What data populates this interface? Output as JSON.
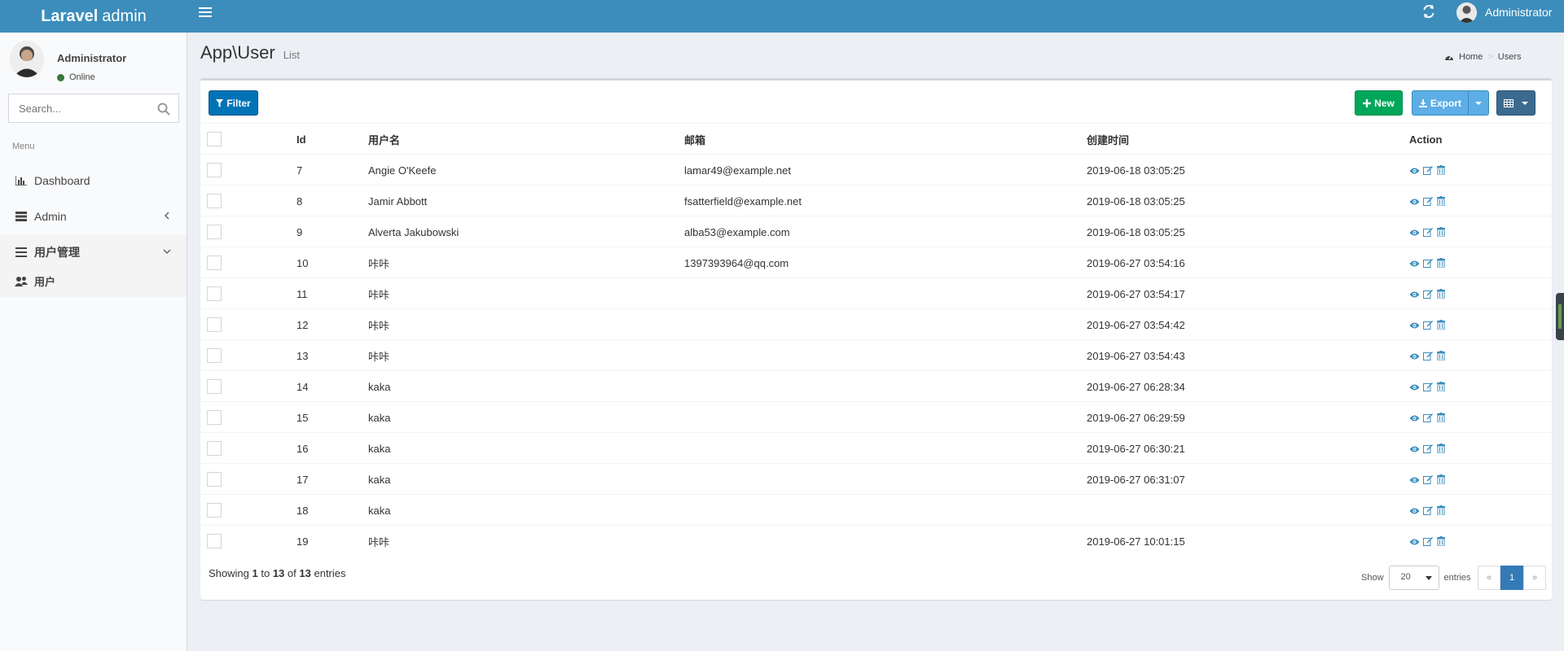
{
  "header": {
    "logo_bold": "Laravel",
    "logo_rest": "admin",
    "user_name": "Administrator"
  },
  "sidebar": {
    "user_name": "Administrator",
    "status": "Online",
    "search_placeholder": "Search...",
    "menu_header": "Menu",
    "items": [
      {
        "label": "Dashboard",
        "icon": "bar-chart-icon"
      },
      {
        "label": "Admin",
        "icon": "tasks-icon"
      },
      {
        "label": "用户管理",
        "icon": "bars-icon"
      }
    ],
    "sub_items": [
      {
        "label": "用户",
        "icon": "users-icon"
      }
    ]
  },
  "content": {
    "title": "App\\User",
    "subtitle": "List",
    "breadcrumb_home": "Home",
    "breadcrumb_current": "Users"
  },
  "toolbar": {
    "filter": "Filter",
    "new": "New",
    "export": "Export"
  },
  "table": {
    "columns": [
      "Id",
      "用户名",
      "邮箱",
      "创建时间",
      "Action"
    ],
    "rows": [
      {
        "id": "7",
        "name": "Angie O'Keefe",
        "email": "lamar49@example.net",
        "created": "2019-06-18 03:05:25"
      },
      {
        "id": "8",
        "name": "Jamir Abbott",
        "email": "fsatterfield@example.net",
        "created": "2019-06-18 03:05:25"
      },
      {
        "id": "9",
        "name": "Alverta Jakubowski",
        "email": "alba53@example.com",
        "created": "2019-06-18 03:05:25"
      },
      {
        "id": "10",
        "name": "咔咔",
        "email": "1397393964@qq.com",
        "created": "2019-06-27 03:54:16"
      },
      {
        "id": "11",
        "name": "咔咔",
        "email": "",
        "created": "2019-06-27 03:54:17"
      },
      {
        "id": "12",
        "name": "咔咔",
        "email": "",
        "created": "2019-06-27 03:54:42"
      },
      {
        "id": "13",
        "name": "咔咔",
        "email": "",
        "created": "2019-06-27 03:54:43"
      },
      {
        "id": "14",
        "name": "kaka",
        "email": "",
        "created": "2019-06-27 06:28:34"
      },
      {
        "id": "15",
        "name": "kaka",
        "email": "",
        "created": "2019-06-27 06:29:59"
      },
      {
        "id": "16",
        "name": "kaka",
        "email": "",
        "created": "2019-06-27 06:30:21"
      },
      {
        "id": "17",
        "name": "kaka",
        "email": "",
        "created": "2019-06-27 06:31:07"
      },
      {
        "id": "18",
        "name": "kaka",
        "email": "",
        "created": ""
      },
      {
        "id": "19",
        "name": "咔咔",
        "email": "",
        "created": "2019-06-27 10:01:15"
      }
    ]
  },
  "footer": {
    "showing": "Showing",
    "from": "1",
    "to_word": "to",
    "to": "13",
    "of_word": "of",
    "total": "13",
    "entries_word": "entries",
    "show_label": "Show",
    "per_page": "20",
    "entries_label": "entries",
    "prev": "«",
    "page": "1",
    "next": "»"
  },
  "colors": {
    "header_bg": "#3c8dbc",
    "btn_filter": "#0073b7",
    "btn_new": "#00a65a",
    "btn_export": "#5dade6",
    "action_icon": "#3c8dbc"
  }
}
